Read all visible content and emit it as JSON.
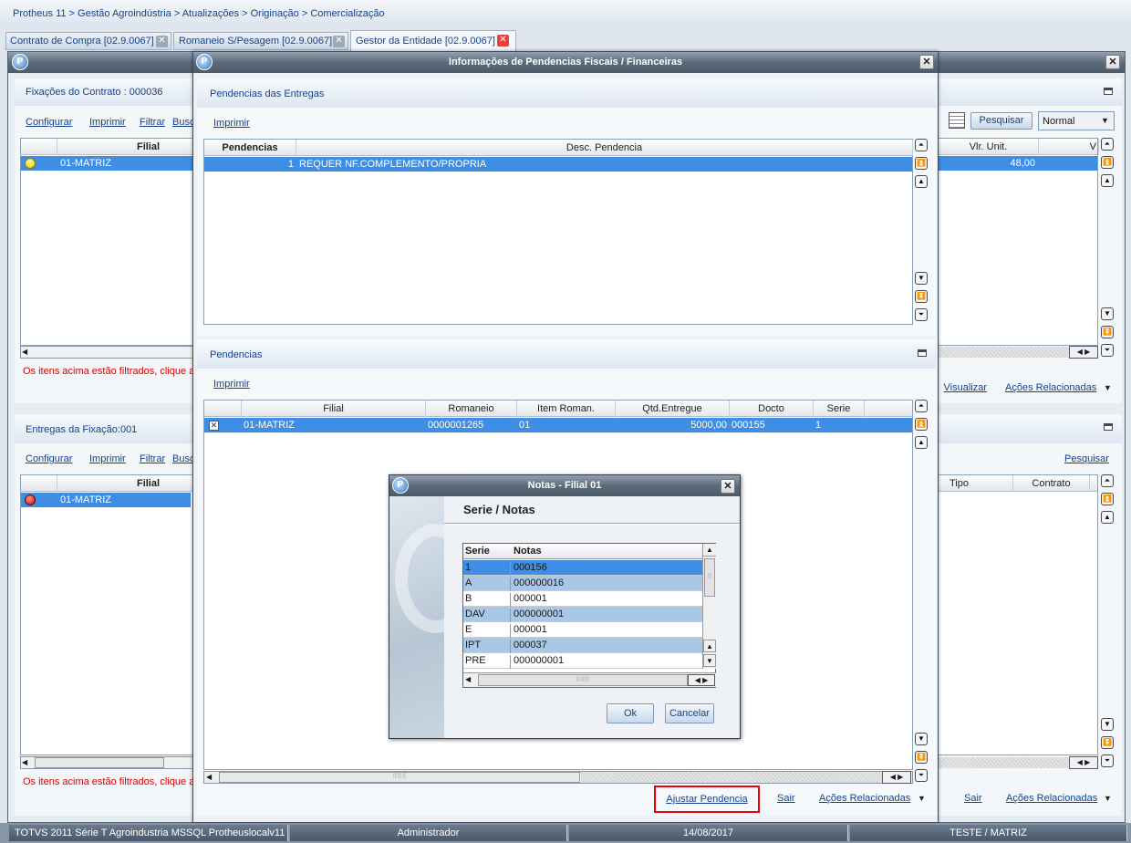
{
  "breadcrumb": "Protheus 11 > Gestão Agroindústria > Atualizações > Originação > Comercialização",
  "tabs": [
    {
      "label": "Contrato de Compra [02.9.0067]"
    },
    {
      "label": "Romaneio S/Pesagem [02.9.0067]"
    },
    {
      "label": "Gestor da Entidade [02.9.0067]"
    }
  ],
  "background": {
    "panel1_title": "Fixações do Contrato : 000036",
    "panel2_title": "Entregas da Fixação:001",
    "toolbar": {
      "configurar": "Configurar",
      "imprimir": "Imprimir",
      "filtrar": "Filtrar",
      "buscar": "Busc"
    },
    "grid1": {
      "col_filial": "Filial",
      "col_vlr_unit": "Vlr. Unit.",
      "col_v": "V",
      "row_filial": "01-MATRIZ",
      "row_vlr": "48,00"
    },
    "grid2": {
      "col_filial": "Filial",
      "col_tipo": "Tipo",
      "col_contrato": "Contrato",
      "row_filial": "01-MATRIZ"
    },
    "filtered_msg": "Os itens acima estão filtrados, clique a",
    "pesquisar_btn": "Pesquisar",
    "pesquisar_link": "Pesquisar",
    "normal_select": "Normal",
    "visualizar": "Visualizar",
    "acoes_relacionadas": "Ações Relacionadas",
    "sair": "Sair"
  },
  "dialog": {
    "title": "Informações de Pendencias Fiscais / Financeiras",
    "panel1_title": "Pendencias  das Entregas",
    "panel1_imprimir": "Imprimir",
    "grid1": {
      "col_pendencias": "Pendencias",
      "col_desc": "Desc. Pendencia",
      "rows": [
        {
          "num": "1",
          "desc": "REQUER NF.COMPLEMENTO/PROPRIA"
        }
      ]
    },
    "panel2_title": "Pendencias",
    "panel2_imprimir": "Imprimir",
    "grid2": {
      "cols": [
        "Filial",
        "Romaneio",
        "Item Roman.",
        "Qtd.Entregue",
        "Docto",
        "Serie"
      ],
      "row": {
        "filial": "01-MATRIZ",
        "romaneio": "0000001265",
        "item": "01",
        "qtd": "5000,00",
        "docto": "000155",
        "serie": "1"
      }
    },
    "ajustar_btn": "Ajustar Pendencia",
    "sair": "Sair",
    "acoes_relacionadas": "Ações Relacionadas"
  },
  "notas": {
    "title": "Notas - Filial 01",
    "heading": "Serie / Notas",
    "col_serie": "Serie",
    "col_notas": "Notas",
    "rows": [
      {
        "serie": "1",
        "nota": "000156"
      },
      {
        "serie": "A",
        "nota": "000000016"
      },
      {
        "serie": "B",
        "nota": "000001"
      },
      {
        "serie": "DAV",
        "nota": "000000001"
      },
      {
        "serie": "E",
        "nota": "000001"
      },
      {
        "serie": "IPT",
        "nota": "000037"
      },
      {
        "serie": "PRE",
        "nota": "000000001"
      }
    ],
    "ok": "Ok",
    "cancelar": "Cancelar"
  },
  "statusbar": {
    "system": "TOTVS 2011 Série T Agroindustria MSSQL Protheuslocalv11",
    "user": "Administrador",
    "date": "14/08/2017",
    "branch": "TESTE / MATRIZ"
  },
  "colors": {
    "accent": "#3d8ee4",
    "highlight_border": "#e8000b",
    "link": "#15428b"
  }
}
